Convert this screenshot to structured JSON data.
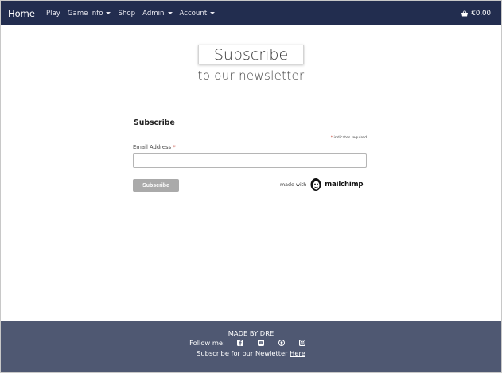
{
  "navbar": {
    "brand": "Home",
    "items": [
      {
        "label": "Play",
        "dropdown": false
      },
      {
        "label": "Game Info",
        "dropdown": true
      },
      {
        "label": "Shop",
        "dropdown": false
      },
      {
        "label": "Admin",
        "dropdown": true
      },
      {
        "label": "Account",
        "dropdown": true
      }
    ],
    "cart": {
      "icon": "basket-icon",
      "amount": "€0.00"
    },
    "background": "#222d4f"
  },
  "heading": {
    "title": "Subscribe",
    "subtitle": "to our newsletter"
  },
  "form": {
    "title": "Subscribe",
    "required_marker": "*",
    "required_note": "indicates required",
    "email_label": "Email Address",
    "email_value": "",
    "submit_label": "Subscribe",
    "made_with": "made with",
    "provider": "mailchimp"
  },
  "footer": {
    "made_by": "MADE BY DRE",
    "follow_label": "Follow me:",
    "social_icons": [
      "facebook-icon",
      "discord-icon",
      "github-icon",
      "instagram-icon"
    ],
    "newsletter_text": "Subscribe for our Newletter",
    "newsletter_link": "Here",
    "background": "#4f5872"
  }
}
